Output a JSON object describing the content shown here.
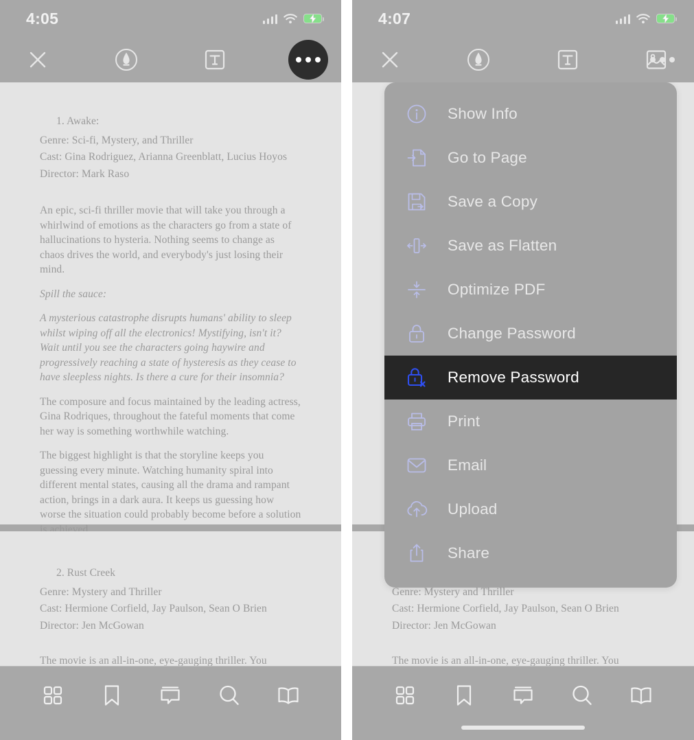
{
  "left_screen": {
    "status": {
      "time": "4:05",
      "signal_icon": "cellular-signal-icon",
      "wifi_icon": "wifi-icon",
      "battery_icon": "battery-charging-icon"
    },
    "toolbar": {
      "close_label": "close-icon",
      "items": [
        {
          "name": "close-button",
          "icon": "close-icon"
        },
        {
          "name": "markup-pen-button",
          "icon": "pen-circle-icon"
        },
        {
          "name": "text-tool-button",
          "icon": "text-box-icon"
        },
        {
          "name": "image-tool-button",
          "icon": "image-icon"
        },
        {
          "name": "more-options-button",
          "icon": "ellipsis-icon"
        }
      ]
    },
    "document": {
      "page1": {
        "title": "1. Awake:",
        "genre": "Genre: Sci-fi, Mystery, and Thriller",
        "cast": "Cast: Gina Rodriguez, Arianna Greenblatt, Lucius Hoyos",
        "director": "Director: Mark Raso",
        "para1": "An epic, sci-fi thriller movie that will take you through a whirlwind of emotions as the characters go from a state of hallucinations to hysteria. Nothing seems to change as chaos drives the world, and everybody's just losing their mind.",
        "spill_heading": "Spill the sauce:",
        "spill_body": "A mysterious catastrophe disrupts humans' ability to sleep whilst wiping off all the electronics! Mystifying, isn't it? Wait until you see the characters going haywire and progressively reaching a state of hysteresis as they cease to have sleepless nights. Is there a cure for their insomnia?",
        "para2": "The composure and focus maintained by the leading actress, Gina Rodriques, throughout the fateful moments that come her way is something worthwhile watching.",
        "para3": "The biggest highlight is that the storyline keeps you guessing every minute. Watching humanity spiral into different mental states, causing all the drama and rampant action, brings in a dark aura. It keeps us guessing how worse the situation could probably become before a solution is achieved.",
        "link": "https://www.netflix.com/title/81218079"
      },
      "page2": {
        "title": "2. Rust Creek",
        "genre": "Genre: Mystery and Thriller",
        "cast": "Cast: Hermione Corfield, Jay Paulson, Sean O Brien",
        "director": "Director: Jen McGowan",
        "para1": "The movie is an all-in-one, eye-gauging thriller. You"
      }
    },
    "bottombar": {
      "items": [
        {
          "name": "thumbnails-button",
          "icon": "grid-icon"
        },
        {
          "name": "bookmarks-button",
          "icon": "bookmark-icon"
        },
        {
          "name": "annotations-button",
          "icon": "comment-icon"
        },
        {
          "name": "search-button",
          "icon": "search-icon"
        },
        {
          "name": "read-mode-button",
          "icon": "book-icon"
        }
      ]
    }
  },
  "right_screen": {
    "status": {
      "time": "4:07",
      "signal_icon": "cellular-signal-icon",
      "wifi_icon": "wifi-icon",
      "battery_icon": "battery-charging-icon"
    },
    "menu": {
      "items": [
        {
          "label": "Show Info",
          "icon": "info-circle-icon",
          "selected": false
        },
        {
          "label": "Go to Page",
          "icon": "go-to-page-icon",
          "selected": false
        },
        {
          "label": "Save a Copy",
          "icon": "floppy-disk-icon",
          "selected": false
        },
        {
          "label": "Save as Flatten",
          "icon": "flatten-icon",
          "selected": false
        },
        {
          "label": "Optimize PDF",
          "icon": "compress-icon",
          "selected": false
        },
        {
          "label": "Change Password",
          "icon": "lock-icon",
          "selected": false
        },
        {
          "label": "Remove Password",
          "icon": "lock-remove-icon",
          "selected": true
        },
        {
          "label": "Print",
          "icon": "printer-icon",
          "selected": false
        },
        {
          "label": "Email",
          "icon": "envelope-icon",
          "selected": false
        },
        {
          "label": "Upload",
          "icon": "cloud-upload-icon",
          "selected": false
        },
        {
          "label": "Share",
          "icon": "share-icon",
          "selected": false
        }
      ]
    },
    "document": {
      "cast": "Cast: Hermione Corfield, Jay Paulson, Sean O Brien",
      "director": "Director: Jen McGowan",
      "para1": "The movie is an all-in-one, eye-gauging thriller. You"
    }
  },
  "colors": {
    "chrome_gray": "#a8a8a8",
    "page_gray": "#e4e4e4",
    "menu_gray": "#a3a3a3",
    "selected_dark": "#262626",
    "accent_blue": "#2f4ff0",
    "menu_icon_lavender": "#b9bde8",
    "link_blue": "#8fb6d6",
    "battery_green": "#86e08a"
  }
}
